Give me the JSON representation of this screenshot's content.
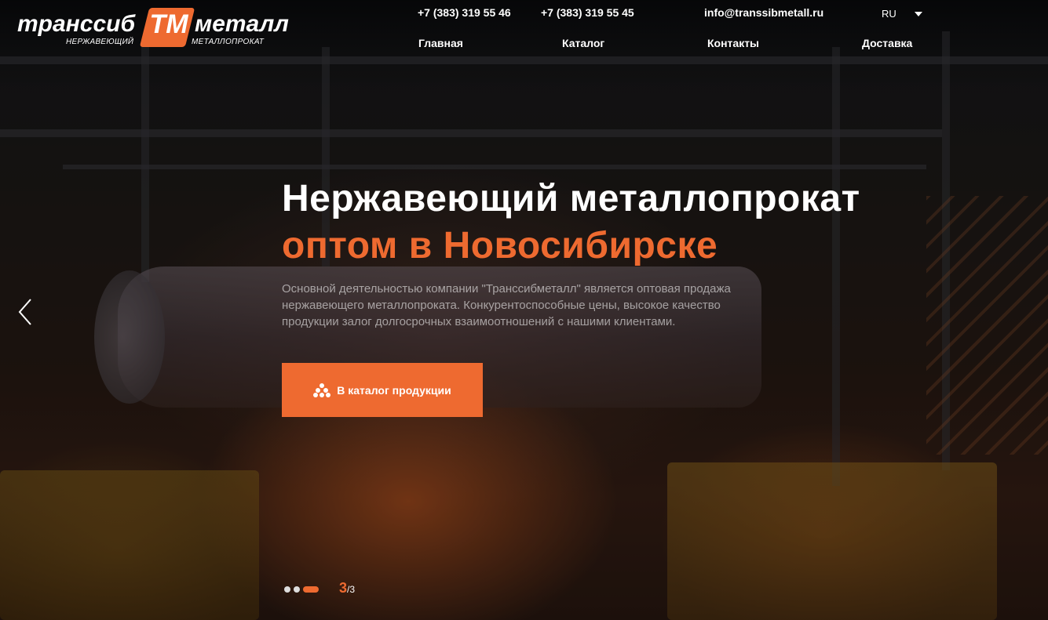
{
  "colors": {
    "accent": "#ee6a30"
  },
  "header": {
    "logo": {
      "left_word": "транссиб",
      "mark": "TM",
      "right_word": "металл",
      "sub_left": "НЕРЖАВЕЮЩИЙ",
      "sub_right": "МЕТАЛЛОПРОКАТ"
    },
    "phone1": "+7 (383) 319 55 46",
    "phone2": "+7 (383) 319 55 45",
    "email": "info@transsibmetall.ru",
    "lang": "RU",
    "lang_icon": "caret-down-icon",
    "nav": [
      {
        "label": "Главная"
      },
      {
        "label": "Каталог"
      },
      {
        "label": "Контакты"
      },
      {
        "label": "Доставка"
      }
    ]
  },
  "hero": {
    "title_line1": "Нержавеющий металлопрокат",
    "title_line2": "оптом в Новосибирске",
    "text": "Основной деятельностью компании \"Транссибметалл\" является оптовая продажа нержавеющего металлопроката. Конкурентоспособные цены, высокое качество продукции залог долгосрочных взаимоотношений с нашими клиентами.",
    "cta_label": "В каталог продукции",
    "cta_icon": "stack-dots-icon",
    "prev_icon": "chevron-left-icon"
  },
  "slider": {
    "current": "3",
    "total": "/3",
    "slides": [
      {
        "active": false
      },
      {
        "active": false
      },
      {
        "active": true
      }
    ]
  }
}
